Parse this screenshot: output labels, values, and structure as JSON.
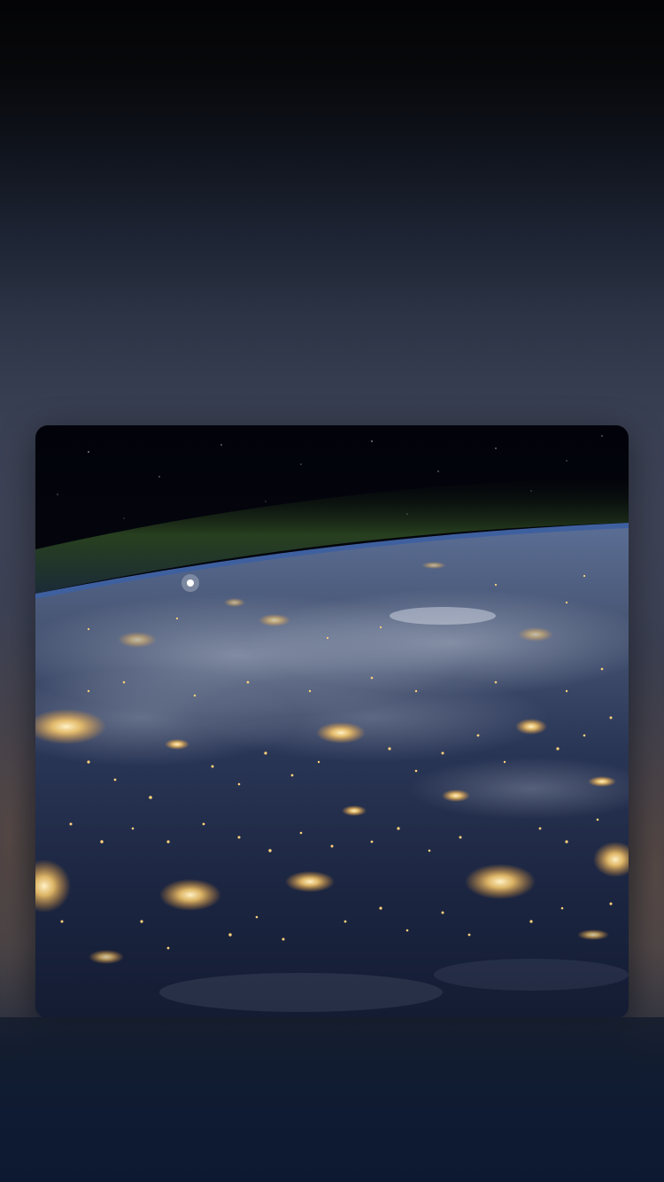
{
  "screen": {
    "type": "media-now-playing",
    "background_colors": [
      "#040406",
      "#3d4255",
      "#0f1c35"
    ]
  },
  "artwork": {
    "subject": "earth-at-night-from-orbit",
    "colors": {
      "space": "#05070c",
      "airglow": "#3a5a2a",
      "atmosphere": "#4a6fb0",
      "ocean": "#1a2744",
      "clouds": "#8f9bb0",
      "city_lights": "#ffd27a"
    }
  }
}
